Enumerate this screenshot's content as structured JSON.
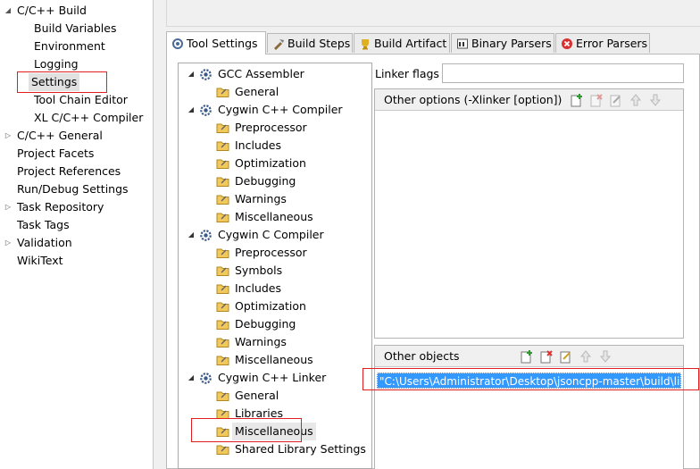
{
  "nav": {
    "items": [
      {
        "label": "C/C++ Build",
        "expanded": true
      },
      {
        "label": "Build Variables"
      },
      {
        "label": "Environment"
      },
      {
        "label": "Logging"
      },
      {
        "label": "Settings",
        "selected": true
      },
      {
        "label": "Tool Chain Editor"
      },
      {
        "label": "XL C/C++ Compiler"
      },
      {
        "label": "C/C++ General",
        "expandable": true
      },
      {
        "label": "Project Facets"
      },
      {
        "label": "Project References"
      },
      {
        "label": "Run/Debug Settings"
      },
      {
        "label": "Task Repository",
        "expandable": true
      },
      {
        "label": "Task Tags"
      },
      {
        "label": "Validation",
        "expandable": true
      },
      {
        "label": "WikiText"
      }
    ]
  },
  "tabs": [
    {
      "label": "Tool Settings",
      "icon": "tool-settings-icon",
      "active": true
    },
    {
      "label": "Build Steps",
      "icon": "build-steps-icon"
    },
    {
      "label": "Build Artifact",
      "icon": "build-artifact-icon"
    },
    {
      "label": "Binary Parsers",
      "icon": "binary-parsers-icon"
    },
    {
      "label": "Error Parsers",
      "icon": "error-parsers-icon"
    }
  ],
  "tool_tree": [
    {
      "label": "GCC Assembler",
      "type": "tool"
    },
    {
      "label": "General",
      "type": "option"
    },
    {
      "label": "Cygwin C++ Compiler",
      "type": "tool"
    },
    {
      "label": "Preprocessor",
      "type": "option"
    },
    {
      "label": "Includes",
      "type": "option"
    },
    {
      "label": "Optimization",
      "type": "option"
    },
    {
      "label": "Debugging",
      "type": "option"
    },
    {
      "label": "Warnings",
      "type": "option"
    },
    {
      "label": "Miscellaneous",
      "type": "option"
    },
    {
      "label": "Cygwin C Compiler",
      "type": "tool"
    },
    {
      "label": "Preprocessor",
      "type": "option"
    },
    {
      "label": "Symbols",
      "type": "option"
    },
    {
      "label": "Includes",
      "type": "option"
    },
    {
      "label": "Optimization",
      "type": "option"
    },
    {
      "label": "Debugging",
      "type": "option"
    },
    {
      "label": "Warnings",
      "type": "option"
    },
    {
      "label": "Miscellaneous",
      "type": "option"
    },
    {
      "label": "Cygwin C++ Linker",
      "type": "tool"
    },
    {
      "label": "General",
      "type": "option"
    },
    {
      "label": "Libraries",
      "type": "option"
    },
    {
      "label": "Miscellaneous",
      "type": "option",
      "selected": true
    },
    {
      "label": "Shared Library Settings",
      "type": "option"
    }
  ],
  "linker_flags": {
    "label": "Linker flags",
    "value": ""
  },
  "other_options": {
    "title": "Other options (-Xlinker [option])",
    "items": []
  },
  "other_objects": {
    "title": "Other objects",
    "items": [
      "\"C:\\Users\\Administrator\\Desktop\\jsoncpp-master\\build\\lib"
    ]
  },
  "colors": {
    "highlight": "#3399ff",
    "annotation": "#e02020"
  }
}
